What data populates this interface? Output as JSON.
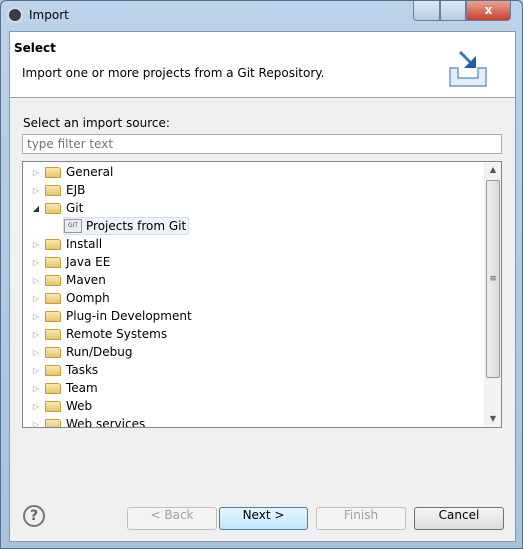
{
  "window": {
    "title": "Import",
    "close_label": "x"
  },
  "header": {
    "title": "Select",
    "description": "Import one or more projects from a Git Repository."
  },
  "source": {
    "label": "Select an import source:",
    "filter_placeholder": "type filter text"
  },
  "tree": [
    {
      "label": "General",
      "expanded": false
    },
    {
      "label": "EJB",
      "expanded": false
    },
    {
      "label": "Git",
      "expanded": true,
      "children": [
        {
          "label": "Projects from Git",
          "selected": true
        }
      ]
    },
    {
      "label": "Install",
      "expanded": false
    },
    {
      "label": "Java EE",
      "expanded": false
    },
    {
      "label": "Maven",
      "expanded": false
    },
    {
      "label": "Oomph",
      "expanded": false
    },
    {
      "label": "Plug-in Development",
      "expanded": false
    },
    {
      "label": "Remote Systems",
      "expanded": false
    },
    {
      "label": "Run/Debug",
      "expanded": false
    },
    {
      "label": "Tasks",
      "expanded": false
    },
    {
      "label": "Team",
      "expanded": false
    },
    {
      "label": "Web",
      "expanded": false
    },
    {
      "label": "Web services",
      "expanded": false
    }
  ],
  "buttons": {
    "help": "?",
    "back": "< Back",
    "next": "Next >",
    "finish": "Finish",
    "cancel": "Cancel"
  }
}
